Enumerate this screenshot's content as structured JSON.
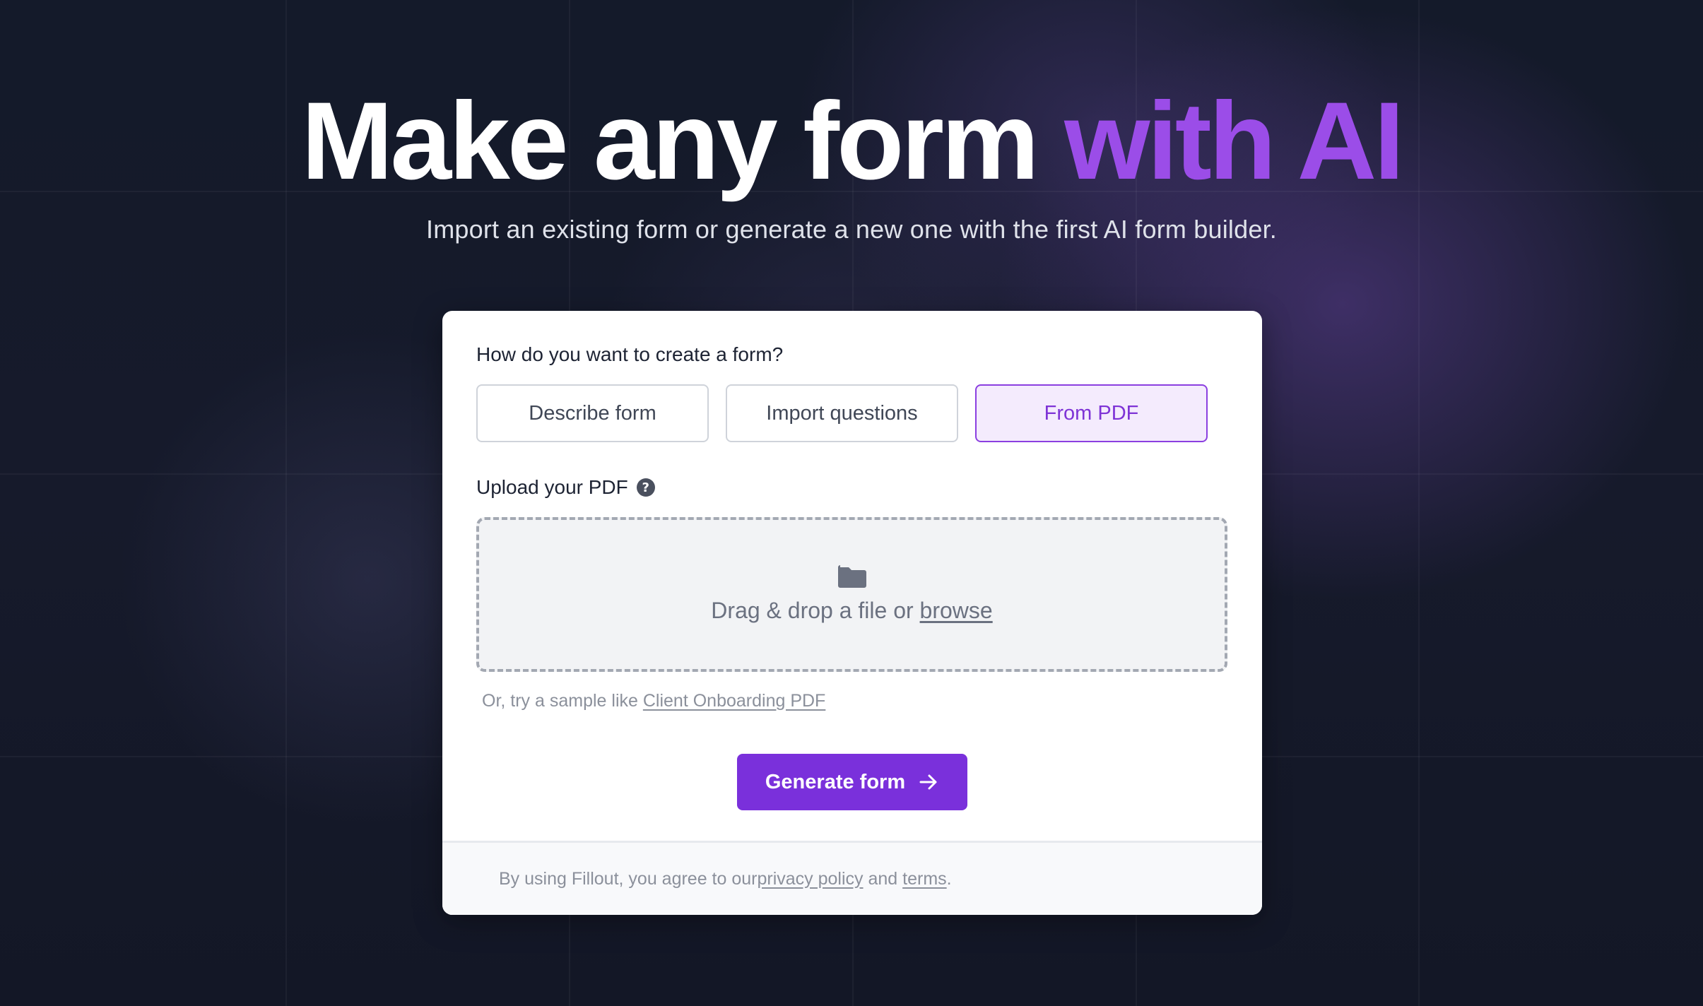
{
  "hero": {
    "title_main": "Make any form ",
    "title_accent": "with AI",
    "subtitle": "Import an existing form or generate a new one with the first AI form builder."
  },
  "card": {
    "question": "How do you want to create a form?",
    "options": [
      {
        "label": "Describe form",
        "selected": false
      },
      {
        "label": "Import questions",
        "selected": false
      },
      {
        "label": "From PDF",
        "selected": true
      }
    ],
    "upload_label": "Upload your PDF",
    "help_icon": "?",
    "dropzone": {
      "icon": "folder-icon",
      "text": "Drag & drop a file or ",
      "browse_label": "browse"
    },
    "sample": {
      "prefix": "Or, try a sample like ",
      "link_label": "Client Onboarding PDF"
    },
    "generate_button": {
      "label": "Generate form",
      "icon": "arrow-right-icon"
    },
    "footer": {
      "prefix": "By using Fillout, you agree to our ",
      "privacy_label": "privacy policy",
      "middle": " and ",
      "terms_label": "terms",
      "suffix": "."
    }
  },
  "colors": {
    "accent": "#9b4de8",
    "button": "#7a30db",
    "background": "#141827"
  }
}
